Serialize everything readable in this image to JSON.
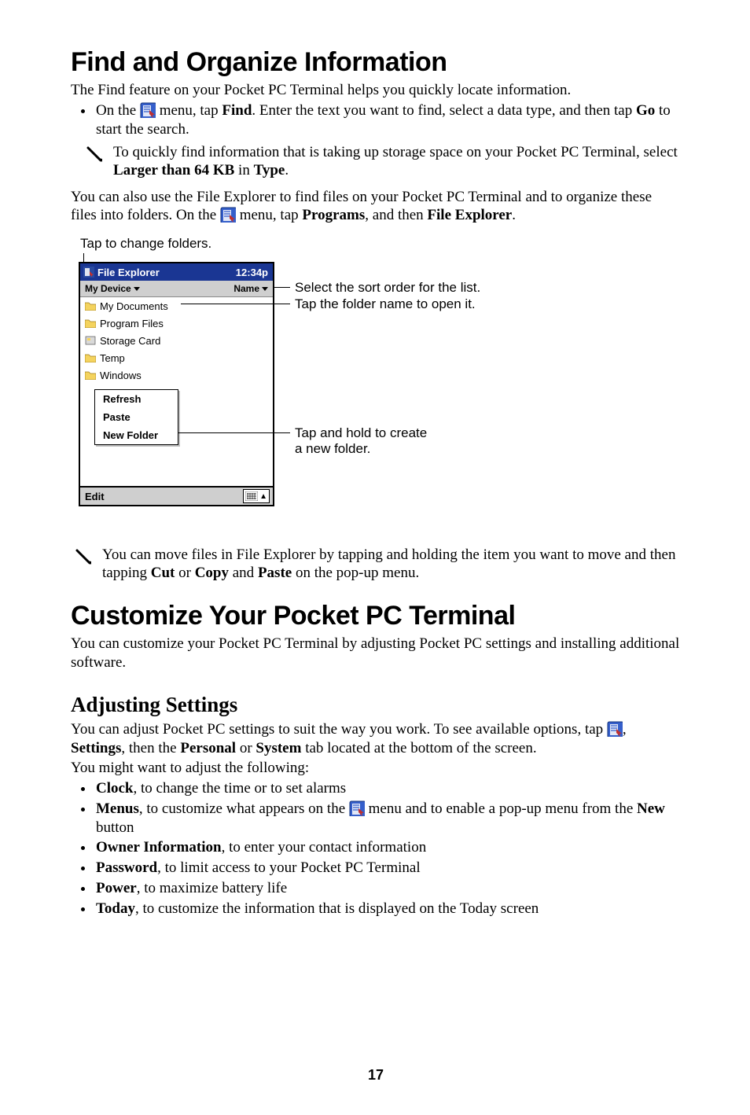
{
  "h1a": "Find and Organize Information",
  "para1": "The Find feature on your Pocket PC Terminal helps you quickly locate information.",
  "bullet1": {
    "pre": "On the ",
    "mid1": " menu, tap ",
    "find": "Find",
    "mid2": ". Enter the text you want to find, select a data type, and then tap ",
    "go": "Go",
    "post": " to start the search."
  },
  "note1": {
    "pre": "To quickly find information that is taking up storage space on your Pocket PC Terminal, select ",
    "b1": "Larger than 64 KB",
    "mid": " in ",
    "b2": "Type",
    "post": "."
  },
  "para2a": "You can also use the File Explorer to find files on your Pocket PC Terminal and to organize these files into folders. On the ",
  "para2b": " menu, tap ",
  "programs": "Programs",
  "para2c": ", and then ",
  "fileexp": "File Explorer",
  "para2d": ".",
  "tap_change": "Tap to change folders.",
  "screenshot": {
    "title": "File Explorer",
    "clock": "12:34p",
    "device": "My Device",
    "sort": "Name",
    "rows": [
      "My Documents",
      "Program Files",
      "Storage Card",
      "Temp",
      "Windows"
    ],
    "menu": [
      "Refresh",
      "Paste",
      "New Folder"
    ],
    "edit": "Edit"
  },
  "callouts": {
    "sort": "Select the sort order for the list.",
    "open": "Tap the folder name to open it.",
    "newfolder1": "Tap and hold to create",
    "newfolder2": "a new folder."
  },
  "note2": {
    "pre": "You can move files in File Explorer by tapping and holding the item you want to move and then tapping ",
    "cut": "Cut",
    "or": " or ",
    "copy": "Copy",
    "and": " and ",
    "paste": "Paste",
    "post": " on the pop-up menu."
  },
  "h1b": "Customize Your Pocket PC Terminal",
  "para3": "You can customize your Pocket PC Terminal by adjusting Pocket PC settings and installing additional software.",
  "h2": "Adjusting Settings",
  "para4a": "You can adjust Pocket PC settings to suit the way you work. To see available options, tap ",
  "para4b": ", ",
  "settings": "Settings",
  "para4c": ", then the ",
  "personal": "Personal",
  "para4d": " or ",
  "system": "System",
  "para4e": " tab located at the bottom of the screen.",
  "para5": "You might want to adjust the following:",
  "list2": {
    "clock_b": "Clock",
    "clock_t": ", to change the time or to set alarms",
    "menus_b": "Menus",
    "menus_t1": ", to customize what appears on the ",
    "menus_t2": " menu and to enable a pop-up menu from the ",
    "new_b": "New",
    "menus_t3": " button",
    "owner_b": "Owner Information",
    "owner_t": ", to enter your contact information",
    "pw_b": "Password",
    "pw_t": ", to limit access to your Pocket PC Terminal",
    "power_b": "Power",
    "power_t": ", to maximize battery life",
    "today_b": "Today",
    "today_t": ", to customize the information that is displayed on the Today screen"
  },
  "page_no": "17"
}
